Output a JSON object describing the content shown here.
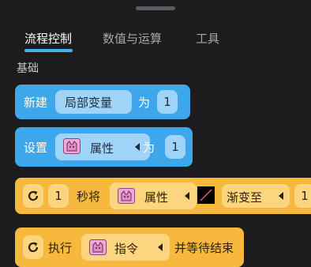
{
  "tabs": [
    {
      "label": "流程控制"
    },
    {
      "label": "数值与运算"
    },
    {
      "label": "工具"
    }
  ],
  "section": {
    "title": "基础"
  },
  "blocks": {
    "new_var": {
      "prefix": "新建",
      "var_name": "局部变量",
      "infix": "为",
      "value": "1"
    },
    "set_attr": {
      "prefix": "设置",
      "attr_label": "属性",
      "infix": "为",
      "value": "1"
    },
    "tween": {
      "seconds": "1",
      "text1": "秒将",
      "attr_label": "属性",
      "text2": "渐变至",
      "value": "1"
    },
    "exec": {
      "prefix": "执行",
      "cmd_label": "指令",
      "suffix": "并等待结束"
    }
  },
  "colors": {
    "tab_accent": "#42b4f0",
    "block_blue": "#3ea7ec",
    "block_orange": "#f6b93d",
    "background": "#1c1c1f"
  },
  "icons": [
    "refresh-icon",
    "cat-sprite-icon",
    "dropdown-arrow-icon",
    "color-swatch-icon"
  ]
}
